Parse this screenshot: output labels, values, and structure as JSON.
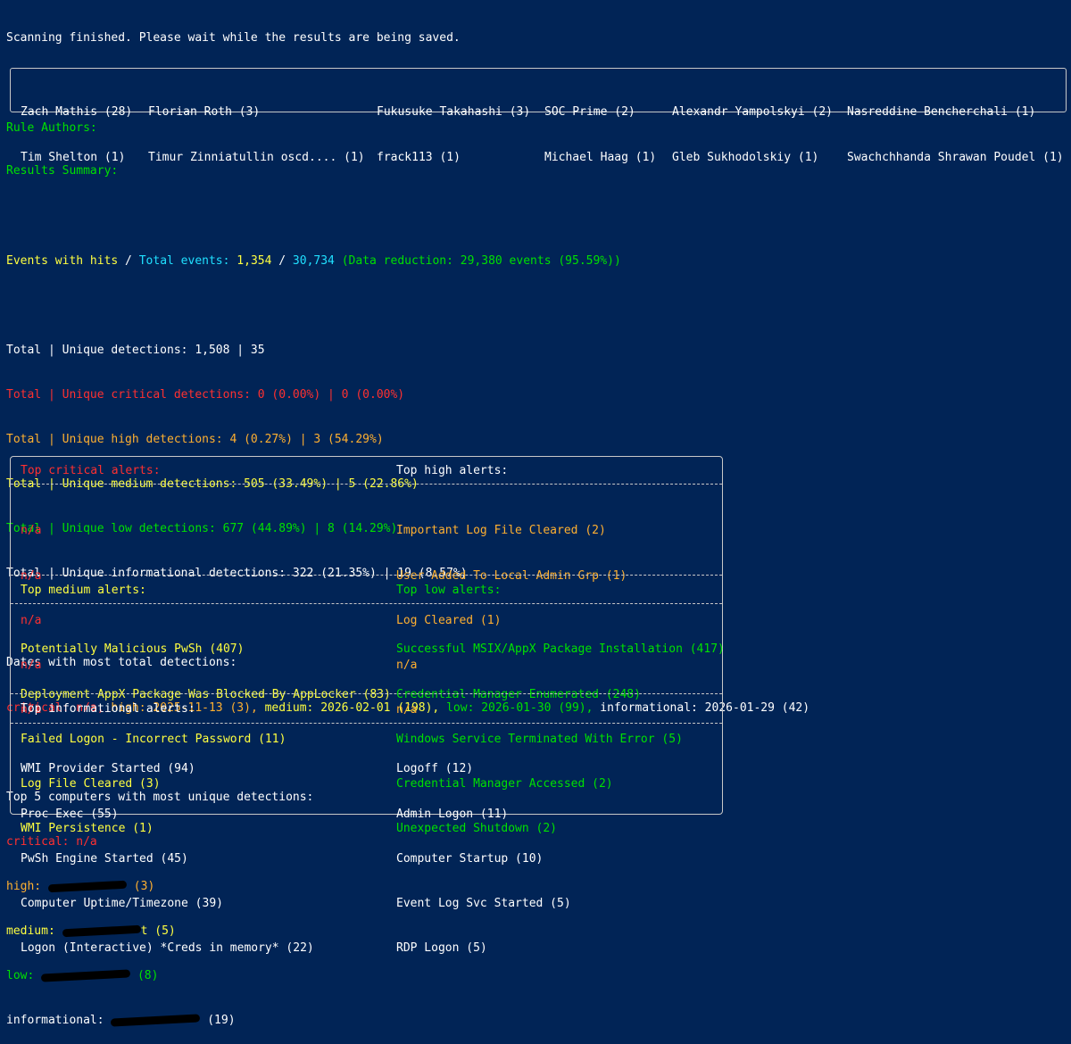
{
  "status_line": "Scanning finished. Please wait while the results are being saved.",
  "rule_authors_label": "Rule Authors:",
  "authors_columns": [
    [
      "Zach Mathis (28)",
      "Tim Shelton (1)"
    ],
    [
      "Florian Roth (3)",
      "Timur Zinniatullin oscd.... (1)"
    ],
    [
      "Fukusuke Takahashi (3)",
      "frack113 (1)"
    ],
    [
      "SOC Prime (2)",
      "Michael Haag (1)"
    ],
    [
      "Alexandr Yampolskyi (2)",
      "Gleb Sukhodolskiy (1)"
    ],
    [
      "Nasreddine Bencherchali (1)",
      "Swachchhanda Shrawan Poudel (1)"
    ]
  ],
  "results_summary_label": "Results Summary:",
  "events": {
    "hits_label": "Events with hits",
    "slash": " / ",
    "total_label": "Total events: ",
    "hits_value": "1,354",
    "total_value": "30,734",
    "reduction_text": "(Data reduction: 29,380 events (95.59%))"
  },
  "detections": [
    "Total | Unique detections: 1,508 | 35",
    "Total | Unique critical detections: 0 (0.00%) | 0 (0.00%)",
    "Total | Unique high detections: 4 (0.27%) | 3 (54.29%)",
    "Total | Unique medium detections: 505 (33.49%) | 5 (22.86%)",
    "Total | Unique low detections: 677 (44.89%) | 8 (14.29%)",
    "Total | Unique informational detections: 322 (21.35%) | 19 (8.57%)"
  ],
  "dates": {
    "label": "Dates with most total detections:",
    "critical": "critical: n/a, ",
    "high": "high: 2025-11-13 (3), ",
    "medium": "medium: 2026-02-01 (198), ",
    "low": "low: 2026-01-30 (99), ",
    "informational": "informational: 2026-01-29 (42)"
  },
  "computers": {
    "label": "Top 5 computers with most unique detections:",
    "critical": "critical: n/a",
    "high_prefix": "high: ",
    "high_suffix": " (3)",
    "medium_prefix": "medium: ",
    "medium_suffix": "t (5)",
    "low_prefix": "low: ",
    "low_suffix": " (8)",
    "info_prefix": "informational: ",
    "info_suffix": " (19)"
  },
  "alerts": {
    "critical_title": "Top critical alerts:",
    "critical": [
      "n/a",
      "n/a",
      "n/a",
      "n/a",
      "n/a"
    ],
    "high_title": "Top high alerts:",
    "high": [
      "Important Log File Cleared (2)",
      "User Added To Local Admin Grp (1)",
      "Log Cleared (1)",
      "n/a",
      "n/a"
    ],
    "medium_title": "Top medium alerts:",
    "medium": [
      "Potentially Malicious PwSh (407)",
      "Deployment AppX Package Was Blocked By AppLocker (83)",
      "Failed Logon - Incorrect Password (11)",
      "Log File Cleared (3)",
      "WMI Persistence (1)"
    ],
    "low_title": "Top low alerts:",
    "low": [
      "Successful MSIX/AppX Package Installation (417)",
      "Credential Manager Enumerated (248)",
      "Windows Service Terminated With Error (5)",
      "Credential Manager Accessed (2)",
      "Unexpected Shutdown (2)"
    ],
    "info_title": "Top informational alerts:",
    "info_left": [
      "WMI Provider Started (94)",
      "Proc Exec (55)",
      "PwSh Engine Started (45)",
      "Computer Uptime/Timezone (39)",
      "Logon (Interactive) *Creds in memory* (22)"
    ],
    "info_right": [
      "Logoff (12)",
      "Admin Logon (11)",
      "Computer Startup (10)",
      "Event Log Svc Started (5)",
      "RDP Logon (5)"
    ]
  },
  "colors": {
    "background": "#012456",
    "critical": "#ff3030",
    "high": "#ffb030",
    "medium": "#ffff40",
    "low": "#00e000",
    "informational": "#ffffff",
    "total_events": "#20e0ff"
  }
}
